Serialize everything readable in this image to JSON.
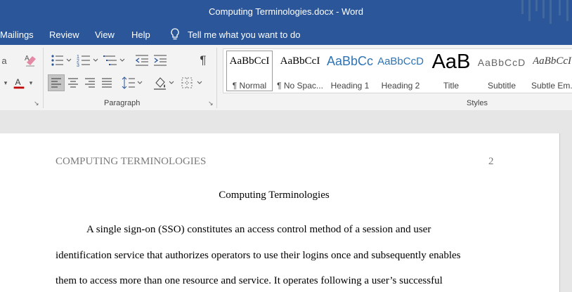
{
  "window": {
    "title": "Computing Terminologies.docx  -  Word"
  },
  "menu": {
    "items": [
      "Mailings",
      "Review",
      "View",
      "Help"
    ],
    "tell_me": "Tell me what you want to do"
  },
  "ribbon": {
    "paragraph_label": "Paragraph",
    "styles_label": "Styles",
    "styles": [
      {
        "preview": "AaBbCcI",
        "name": "¶ Normal",
        "selected": true
      },
      {
        "preview": "AaBbCcI",
        "name": "¶ No Spac..."
      },
      {
        "preview": "AaBbCc",
        "name": "Heading 1"
      },
      {
        "preview": "AaBbCcD",
        "name": "Heading 2"
      },
      {
        "preview": "AaB",
        "name": "Title"
      },
      {
        "preview": "AaBbCcD",
        "name": "Subtitle"
      },
      {
        "preview": "AaBbCcI",
        "name": "Subtle Em..."
      }
    ],
    "colors": {
      "accent": "#2b579a",
      "font_color": "#c00000",
      "heading": "#2e74b5"
    },
    "icons": [
      "eraser-icon",
      "font-color-icon",
      "bullets-icon",
      "numbering-icon",
      "multilevel-icon",
      "decrease-indent-icon",
      "increase-indent-icon",
      "pilcrow-icon",
      "align-left-icon",
      "align-center-icon",
      "align-right-icon",
      "justify-icon",
      "line-spacing-icon",
      "shading-icon",
      "borders-icon"
    ]
  },
  "document": {
    "header_text": "COMPUTING TERMINOLOGIES",
    "page_number": "2",
    "title": "Computing Terminologies",
    "lines": [
      "A single sign-on (SSO) constitutes an access control method of a session and user",
      "identification service that authorizes operators to use their logins once and subsequently enables",
      "them to access more than one resource and service. It operates following a user’s successful"
    ]
  }
}
